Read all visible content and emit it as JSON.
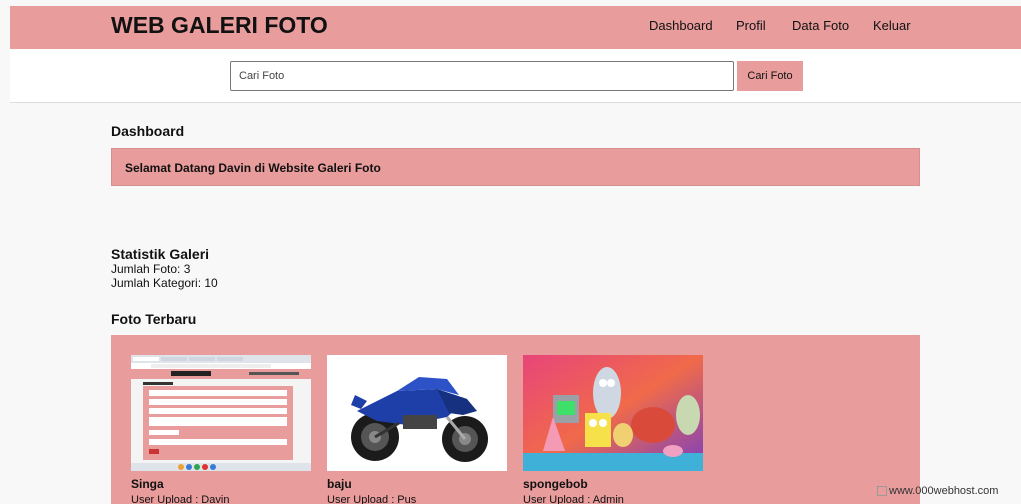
{
  "header": {
    "brand": "WEB GALERI FOTO",
    "nav": [
      "Dashboard",
      "Profil",
      "Data Foto",
      "Keluar"
    ]
  },
  "search": {
    "placeholder": "Cari Foto",
    "button_label": "Cari Foto"
  },
  "dashboard": {
    "title": "Dashboard",
    "welcome": "Selamat Datang Davin di Website Galeri Foto"
  },
  "stats": {
    "title": "Statistik Galeri",
    "total_photos": "Jumlah Foto: 3",
    "total_categories": "Jumlah Kategori: 10"
  },
  "latest": {
    "title": "Foto Terbaru",
    "photos": [
      {
        "title": "Singa",
        "uploader": "User Upload : Davin"
      },
      {
        "title": "baju",
        "uploader": "User Upload : Pus"
      },
      {
        "title": "spongebob",
        "uploader": "User Upload : Admin"
      }
    ]
  },
  "footer": {
    "watermark": "www.000webhost.com"
  }
}
